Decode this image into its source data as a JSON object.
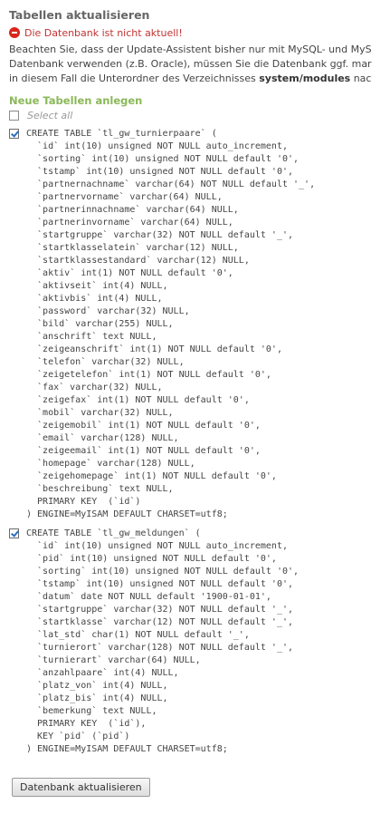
{
  "page": {
    "title": "Tabellen aktualisieren",
    "error_message": "Die Datenbank ist nicht aktuell!",
    "intro_line1": "Beachten Sie, dass der Update-Assistent bisher nur mit MySQL- und MyS",
    "intro_line2": "Datenbank verwenden (z.B. Oracle), müssen Sie die Datenbank ggf. mar",
    "intro_line3_pre": "in diesem Fall die Unterordner des Verzeichnisses ",
    "intro_line3_bold": "system/modules",
    "intro_line3_post": " nac"
  },
  "section": {
    "title": "Neue Tabellen anlegen",
    "select_all_label": "Select all",
    "select_all_checked": false
  },
  "tables": [
    {
      "checked": true,
      "sql": "CREATE TABLE `tl_gw_turnierpaare` (\n  `id` int(10) unsigned NOT NULL auto_increment,\n  `sorting` int(10) unsigned NOT NULL default '0',\n  `tstamp` int(10) unsigned NOT NULL default '0',\n  `partnernachname` varchar(64) NOT NULL default '_',\n  `partnervorname` varchar(64) NULL,\n  `partnerinnachname` varchar(64) NULL,\n  `partnerinvorname` varchar(64) NULL,\n  `startgruppe` varchar(32) NOT NULL default '_',\n  `startklasselatein` varchar(12) NULL,\n  `startklassestandard` varchar(12) NULL,\n  `aktiv` int(1) NOT NULL default '0',\n  `aktivseit` int(4) NULL,\n  `aktivbis` int(4) NULL,\n  `password` varchar(32) NULL,\n  `bild` varchar(255) NULL,\n  `anschrift` text NULL,\n  `zeigeanschrift` int(1) NOT NULL default '0',\n  `telefon` varchar(32) NULL,\n  `zeigetelefon` int(1) NOT NULL default '0',\n  `fax` varchar(32) NULL,\n  `zeigefax` int(1) NOT NULL default '0',\n  `mobil` varchar(32) NULL,\n  `zeigemobil` int(1) NOT NULL default '0',\n  `email` varchar(128) NULL,\n  `zeigeemail` int(1) NOT NULL default '0',\n  `homepage` varchar(128) NULL,\n  `zeigehomepage` int(1) NOT NULL default '0',\n  `beschreibung` text NULL,\n  PRIMARY KEY  (`id`)\n) ENGINE=MyISAM DEFAULT CHARSET=utf8;"
    },
    {
      "checked": true,
      "sql": "CREATE TABLE `tl_gw_meldungen` (\n  `id` int(10) unsigned NOT NULL auto_increment,\n  `pid` int(10) unsigned NOT NULL default '0',\n  `sorting` int(10) unsigned NOT NULL default '0',\n  `tstamp` int(10) unsigned NOT NULL default '0',\n  `datum` date NOT NULL default '1900-01-01',\n  `startgruppe` varchar(32) NOT NULL default '_',\n  `startklasse` varchar(12) NOT NULL default '_',\n  `lat_std` char(1) NOT NULL default '_',\n  `turnierort` varchar(128) NOT NULL default '_',\n  `turnierart` varchar(64) NULL,\n  `anzahlpaare` int(4) NULL,\n  `platz_von` int(4) NULL,\n  `platz_bis` int(4) NULL,\n  `bemerkung` text NULL,\n  PRIMARY KEY  (`id`),\n  KEY `pid` (`pid`)\n) ENGINE=MyISAM DEFAULT CHARSET=utf8;"
    }
  ],
  "actions": {
    "submit_label": "Datenbank aktualisieren"
  },
  "colors": {
    "section_title": "#8ab858",
    "error_text": "#c33333",
    "error_icon": "#d9261c"
  },
  "icons": {
    "error": "error-circle-icon",
    "checkbox_checked": "checkmark-icon"
  }
}
